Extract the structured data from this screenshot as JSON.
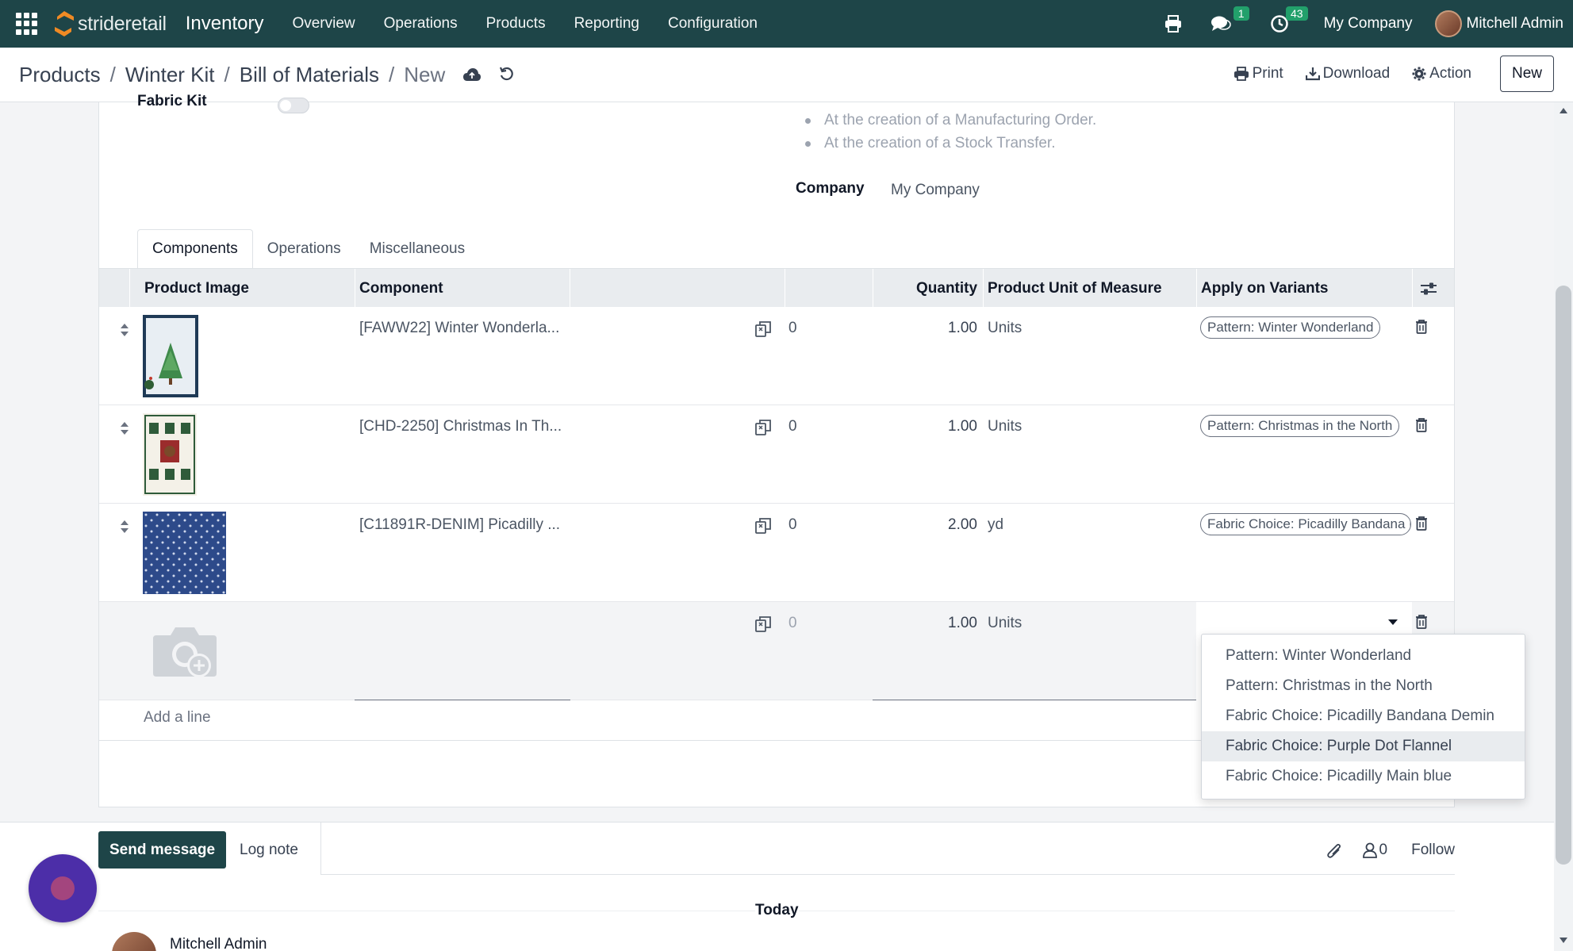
{
  "colors": {
    "navbar": "#1e4548",
    "badge": "#22a06b",
    "fab": "#4c2ea8"
  },
  "navbar": {
    "brand_prefix": "stride",
    "brand_suffix": "retail",
    "app_name": "Inventory",
    "menu": [
      "Overview",
      "Operations",
      "Products",
      "Reporting",
      "Configuration"
    ],
    "messages_badge": "1",
    "activities_badge": "43",
    "company": "My Company",
    "user": "Mitchell Admin"
  },
  "breadcrumb": {
    "items": [
      "Products",
      "Winter Kit",
      "Bill of Materials"
    ],
    "current": "New",
    "separator": "/"
  },
  "actions": {
    "print": "Print",
    "download": "Download",
    "action": "Action",
    "new": "New"
  },
  "form": {
    "fabric_kit_label": "Fabric Kit",
    "fabric_kit_enabled": false,
    "bullets": [
      "At the creation of a Manufacturing Order.",
      "At the creation of a Stock Transfer."
    ],
    "company_label": "Company",
    "company_value": "My Company"
  },
  "tabs": [
    "Components",
    "Operations",
    "Miscellaneous"
  ],
  "table": {
    "headers": {
      "image": "Product Image",
      "component": "Component",
      "quantity": "Quantity",
      "uom": "Product Unit of Measure",
      "variants": "Apply on Variants"
    },
    "rows": [
      {
        "component": "[FAWW22] Winter Wonderla...",
        "count": "0",
        "quantity": "1.00",
        "uom": "Units",
        "variant": "Pattern: Winter Wonderland"
      },
      {
        "component": "[CHD-2250] Christmas In Th...",
        "count": "0",
        "quantity": "1.00",
        "uom": "Units",
        "variant": "Pattern: Christmas in the North"
      },
      {
        "component": "[C11891R-DENIM] Picadilly ...",
        "count": "0",
        "quantity": "2.00",
        "uom": "yd",
        "variant": "Fabric Choice: Picadilly Bandana Demin"
      }
    ],
    "new_row": {
      "count": "0",
      "quantity": "1.00",
      "uom": "Units"
    },
    "add_line": "Add a line"
  },
  "dropdown": {
    "options": [
      "Pattern: Winter Wonderland",
      "Pattern: Christmas in the North",
      "Fabric Choice: Picadilly Bandana Demin",
      "Fabric Choice: Purple Dot Flannel",
      "Fabric Choice: Picadilly Main blue"
    ],
    "highlighted_index": 3
  },
  "chatter": {
    "send_message": "Send message",
    "log_note": "Log note",
    "followers_count": "0",
    "follow": "Follow",
    "today": "Today",
    "author": "Mitchell Admin"
  }
}
